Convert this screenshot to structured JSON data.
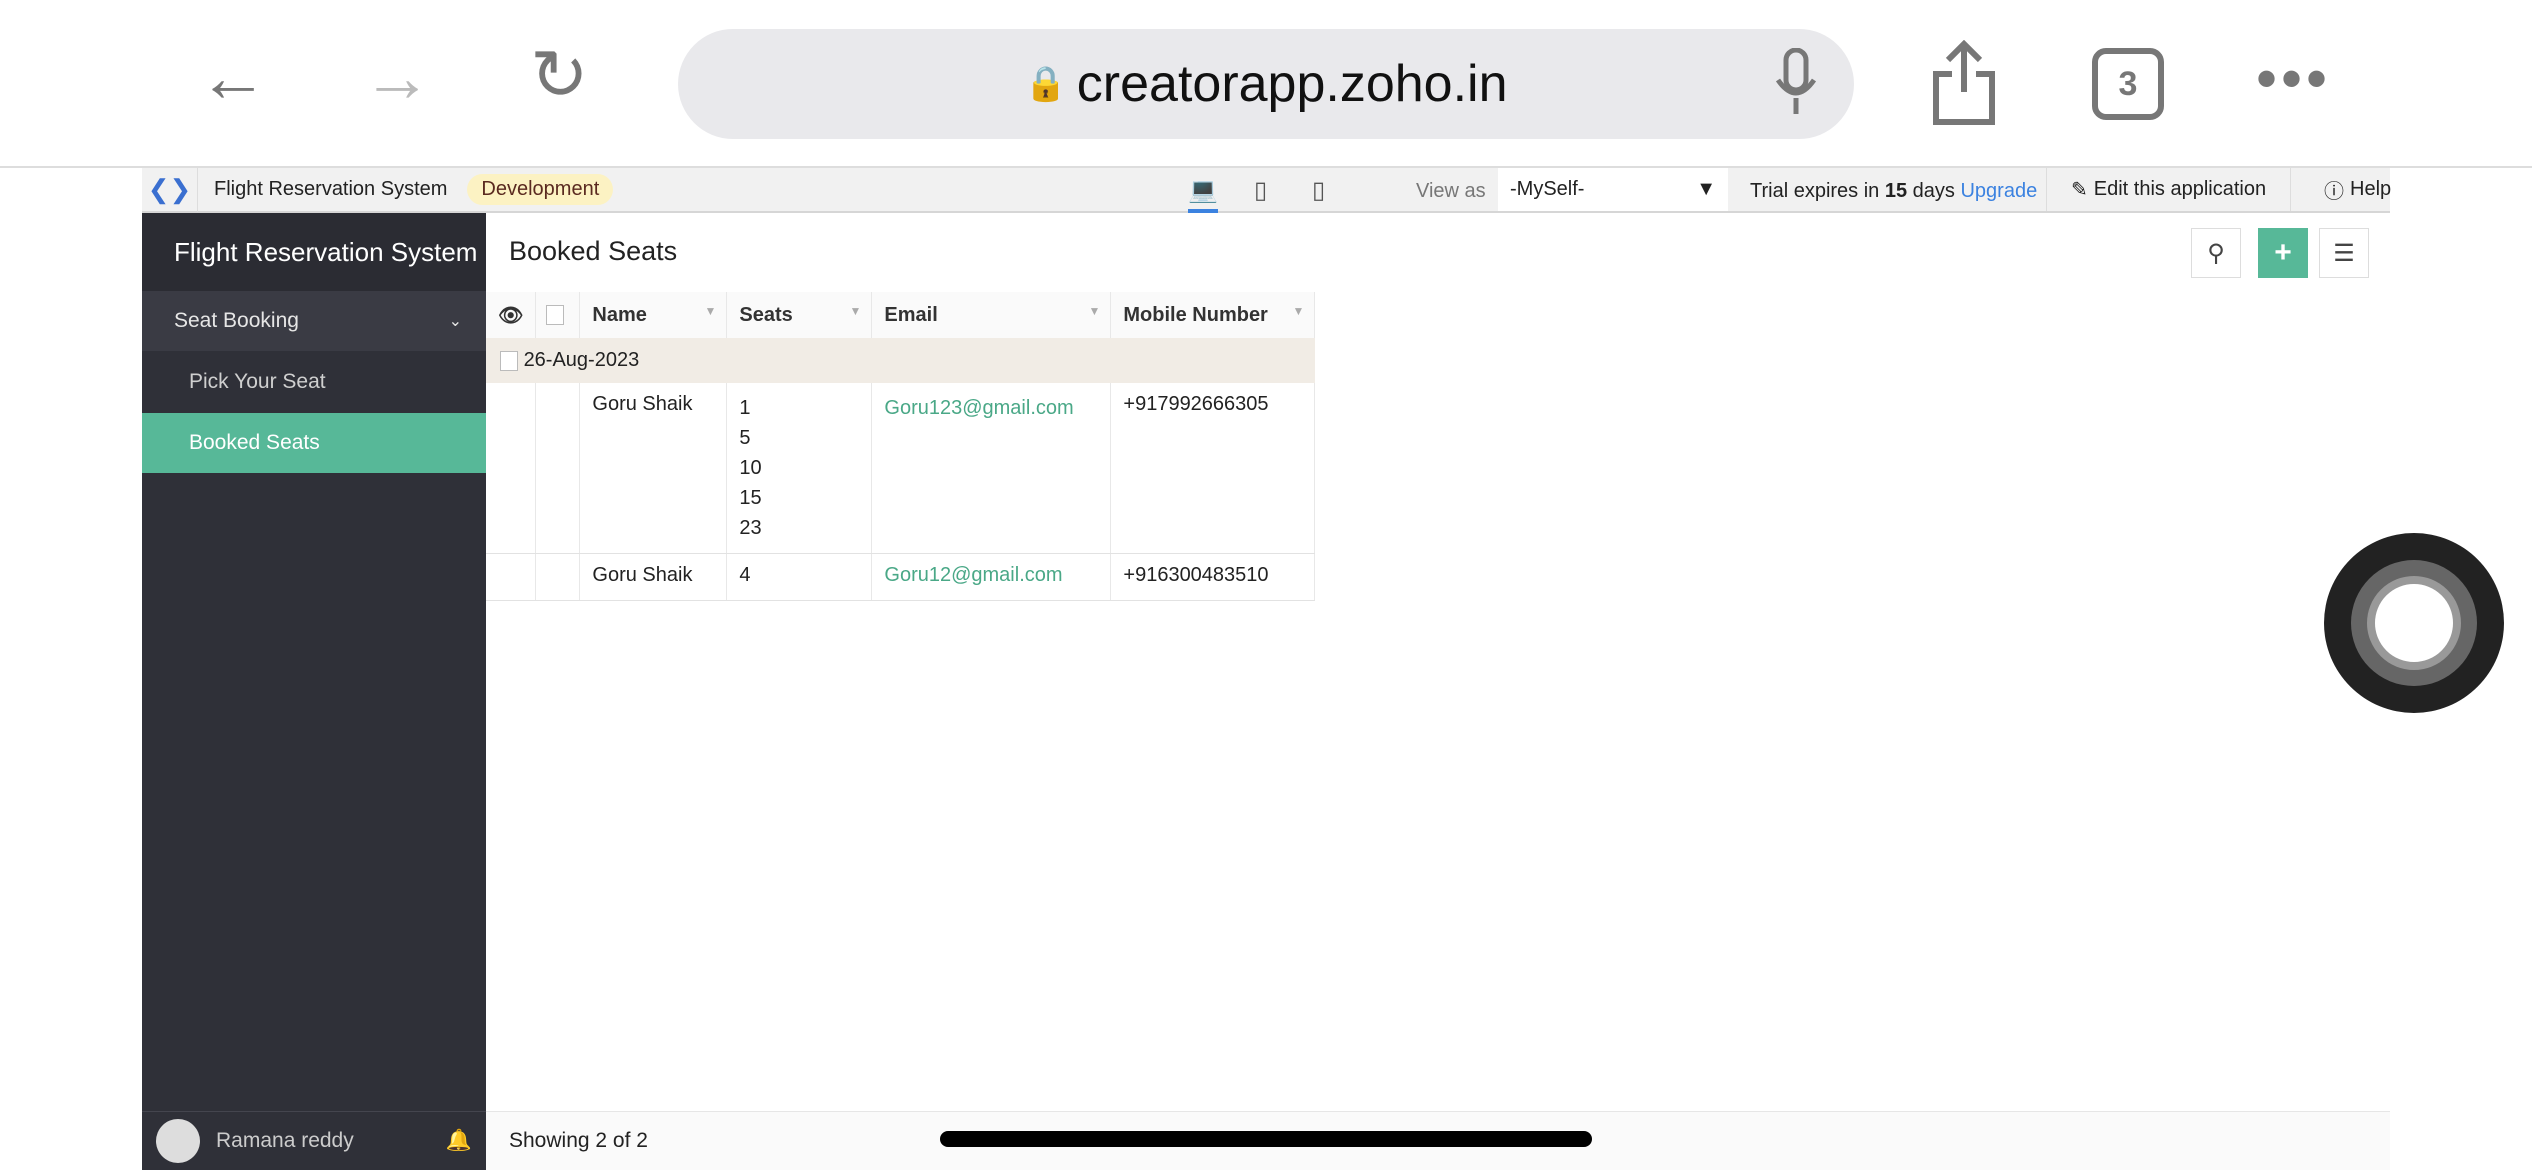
{
  "browser": {
    "url": "creatorapp.zoho.in",
    "tab_count": "3"
  },
  "topbar": {
    "app_name": "Flight Reservation System",
    "env_badge": "Development",
    "view_as_label": "View as",
    "view_as_value": "-MySelf-",
    "trial_prefix": "Trial expires in ",
    "trial_days": "15",
    "trial_suffix": " days ",
    "upgrade": "Upgrade",
    "edit_app": "Edit this application",
    "help": "Help"
  },
  "sidebar": {
    "title": "Flight Reservation System",
    "section": "Seat Booking",
    "items": [
      {
        "label": "Pick Your Seat"
      },
      {
        "label": "Booked Seats"
      }
    ],
    "user": "Ramana reddy"
  },
  "main": {
    "title": "Booked Seats",
    "columns": [
      "Name",
      "Seats",
      "Email",
      "Mobile Number"
    ],
    "group": "26-Aug-2023",
    "rows": [
      {
        "name": "Goru Shaik",
        "seats": [
          "1",
          "5",
          "10",
          "15",
          "23"
        ],
        "email": "Goru123@gmail.com",
        "mobile": "+917992666305"
      },
      {
        "name": "Goru Shaik",
        "seats": [
          "4"
        ],
        "email": "Goru12@gmail.com",
        "mobile": "+916300483510"
      }
    ],
    "footer": "Showing 2 of 2"
  },
  "colors": {
    "accent": "#57b898",
    "sidebar": "#2f3038",
    "link": "#3b82e0"
  }
}
